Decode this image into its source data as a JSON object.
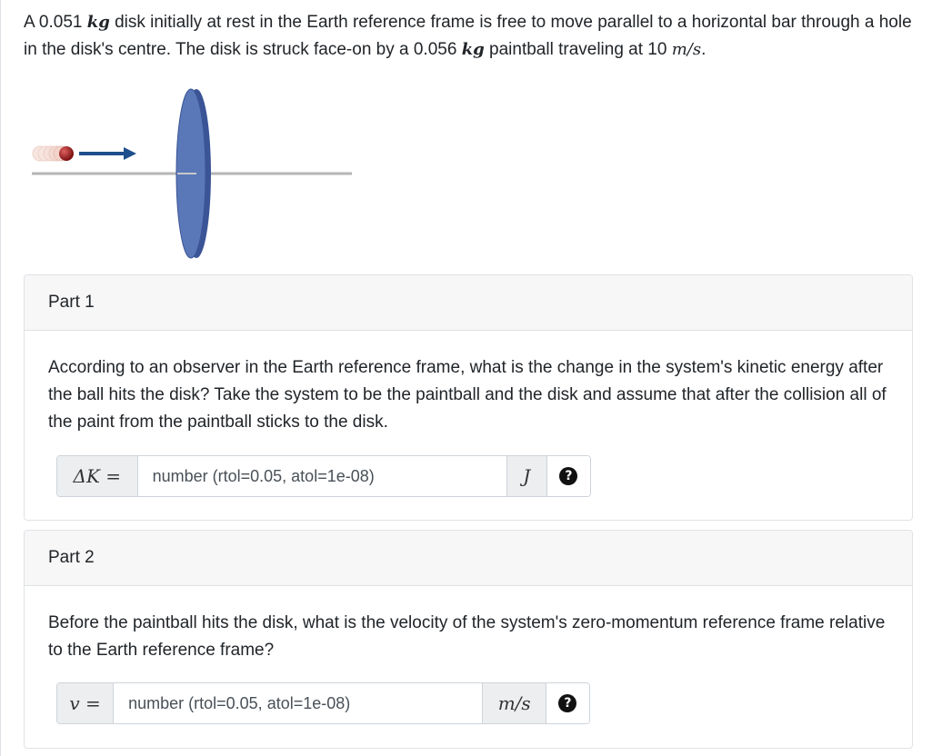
{
  "intro": {
    "p1": "A 0.051 ",
    "u1": "kg",
    "p2": " disk initially at rest in the Earth reference frame is free to move parallel to a horizontal bar through a hole in the disk's centre. The disk is struck face-on by a 0.056 ",
    "u2": "kg",
    "p3": " paintball traveling at 10 ",
    "u3": "m/s",
    "p4": "."
  },
  "parts": [
    {
      "title": "Part 1",
      "question": "According to an observer in the Earth reference frame, what is the change in the system's kinetic energy after the ball hits the disk? Take the system to be the paintball and the disk and assume that after the collision all of the paint from the paintball sticks to the disk.",
      "label": "ΔK =",
      "placeholder": "number (rtol=0.05, atol=1e-08)",
      "unit": "J",
      "help": "?"
    },
    {
      "title": "Part 2",
      "question": "Before the paintball hits the disk, what is the velocity of the system's zero-momentum reference frame relative to the Earth reference frame?",
      "label": "v =",
      "placeholder": "number (rtol=0.05, atol=1e-08)",
      "unit": "m/s",
      "help": "?"
    }
  ],
  "colors": {
    "disk": "#5a78b8",
    "disk_edge": "#3a5496",
    "ball": "#b02a2a",
    "arrow": "#1f4e8c",
    "bar": "#b5b5b5"
  }
}
